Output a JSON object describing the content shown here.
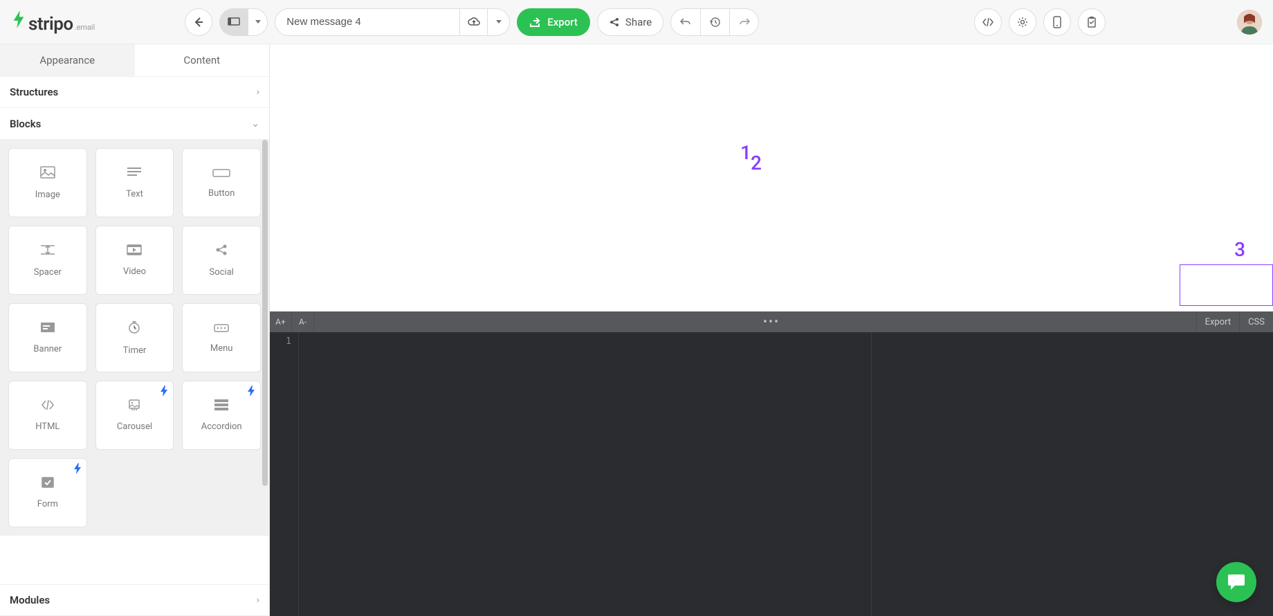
{
  "logo": {
    "text": "stripo",
    "sub": ".email"
  },
  "toolbar": {
    "title_value": "New message 4",
    "export_label": "Export",
    "share_label": "Share"
  },
  "sidebar": {
    "tabs": {
      "appearance": "Appearance",
      "content": "Content"
    },
    "sections": {
      "structures": "Structures",
      "blocks": "Blocks",
      "modules": "Modules"
    },
    "blocks": [
      {
        "label": "Image",
        "icon": "image",
        "bolt": false
      },
      {
        "label": "Text",
        "icon": "text",
        "bolt": false
      },
      {
        "label": "Button",
        "icon": "button",
        "bolt": false
      },
      {
        "label": "Spacer",
        "icon": "spacer",
        "bolt": false
      },
      {
        "label": "Video",
        "icon": "video",
        "bolt": false
      },
      {
        "label": "Social",
        "icon": "social",
        "bolt": false
      },
      {
        "label": "Banner",
        "icon": "banner",
        "bolt": false
      },
      {
        "label": "Timer",
        "icon": "timer",
        "bolt": false
      },
      {
        "label": "Menu",
        "icon": "menu",
        "bolt": false
      },
      {
        "label": "HTML",
        "icon": "html",
        "bolt": false
      },
      {
        "label": "Carousel",
        "icon": "carousel",
        "bolt": true
      },
      {
        "label": "Accordion",
        "icon": "accordion",
        "bolt": true
      },
      {
        "label": "Form",
        "icon": "form",
        "bolt": true
      }
    ]
  },
  "code_toolbar": {
    "zoom_in": "A+",
    "zoom_out": "A-",
    "export": "Export",
    "css": "CSS"
  },
  "code": {
    "line1": "1"
  },
  "annotations": {
    "a1": "1",
    "a2": "2",
    "a3": "3"
  }
}
